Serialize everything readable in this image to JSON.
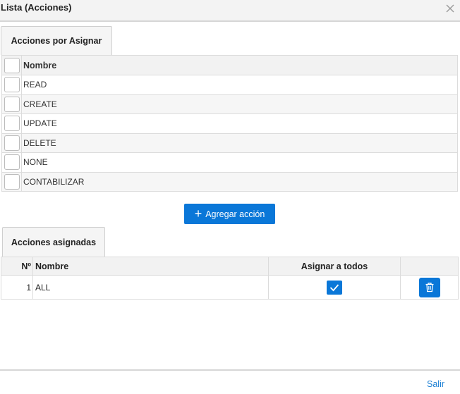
{
  "dialog": {
    "title": "Lista (Acciones)",
    "close_icon": "close-icon"
  },
  "unassigned": {
    "tab_label": "Acciones por Asignar",
    "header_name": "Nombre",
    "rows": [
      "READ",
      "CREATE",
      "UPDATE",
      "DELETE",
      "NONE",
      "CONTABILIZAR"
    ]
  },
  "add_button": {
    "label": "Agregar acción",
    "icon": "plus-icon"
  },
  "assigned": {
    "tab_label": "Acciones asignadas",
    "headers": {
      "number": "Nº",
      "name": "Nombre",
      "assign_all": "Asignar a todos",
      "actions": ""
    },
    "rows": [
      {
        "number": "1",
        "name": "ALL",
        "assign_all_checked": true
      }
    ]
  },
  "footer": {
    "exit_label": "Salir"
  },
  "colors": {
    "accent": "#0a77d8",
    "link": "#1a7fd4"
  }
}
